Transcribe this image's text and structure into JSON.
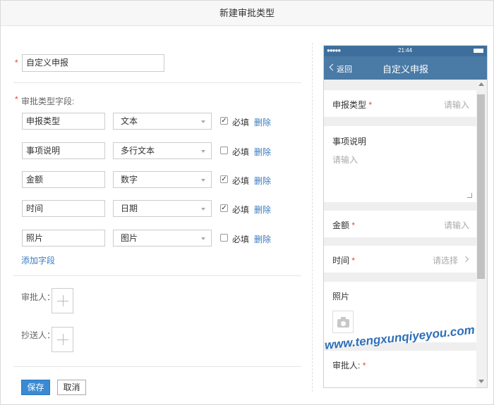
{
  "dialog": {
    "title": "新建审批类型"
  },
  "form": {
    "required_mark": "*",
    "name_value": "自定义申报",
    "fields_label": "审批类型字段:",
    "fields": [
      {
        "name": "申报类型",
        "type": "文本",
        "required": true,
        "required_label": "必填",
        "delete_label": "删除"
      },
      {
        "name": "事项说明",
        "type": "多行文本",
        "required": false,
        "required_label": "必填",
        "delete_label": "删除"
      },
      {
        "name": "金额",
        "type": "数字",
        "required": true,
        "required_label": "必填",
        "delete_label": "删除"
      },
      {
        "name": "时间",
        "type": "日期",
        "required": true,
        "required_label": "必填",
        "delete_label": "删除"
      },
      {
        "name": "照片",
        "type": "图片",
        "required": false,
        "required_label": "必填",
        "delete_label": "删除"
      }
    ],
    "add_field_label": "添加字段",
    "approver_label": "审批人：",
    "cc_label": "抄送人：",
    "save_label": "保存",
    "cancel_label": "取消"
  },
  "preview": {
    "status_signal": "●●●●●",
    "status_time": "21:44",
    "back_label": "返回",
    "title": "自定义申报",
    "items": {
      "type_label": "申报类型",
      "type_placeholder": "请输入",
      "desc_label": "事项说明",
      "desc_placeholder": "请输入",
      "amount_label": "金额",
      "amount_placeholder": "请输入",
      "time_label": "时间",
      "time_placeholder": "请选择",
      "photo_label": "照片",
      "approver_label": "审批人:"
    }
  },
  "watermark": "www.tengxunqiyeyou.com",
  "colors": {
    "accent": "#3a8ad3",
    "link": "#3a7bc0",
    "nav_bar": "#4a7aa6",
    "required": "#e64340"
  }
}
